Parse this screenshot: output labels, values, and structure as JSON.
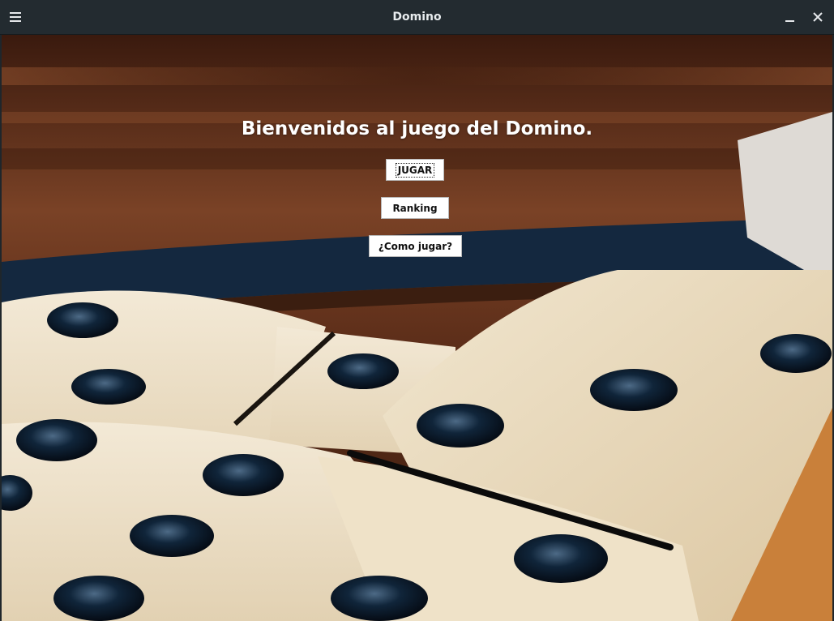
{
  "window": {
    "title": "Domino",
    "icons": {
      "menu": "hamburger-menu-icon",
      "minimize": "minimize-icon",
      "close": "close-icon"
    }
  },
  "main": {
    "heading": "Bienvenidos al juego del Domino.",
    "buttons": {
      "play": "JUGAR",
      "ranking": "Ranking",
      "how_to": "¿Como jugar?"
    }
  },
  "colors": {
    "titlebar": "#232b30",
    "title_text": "#e8ecee",
    "table_wood": "#6b3720",
    "domino_ivory": "#efe3cb",
    "pip": "#0e1c2c"
  }
}
